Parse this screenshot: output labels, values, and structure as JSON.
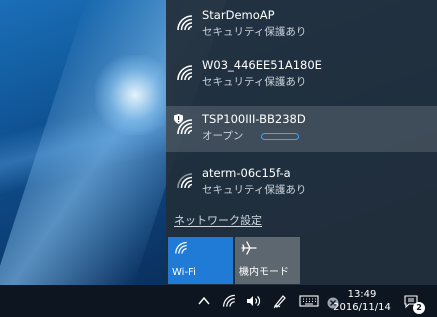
{
  "networks": [
    {
      "name": "StarDemoAP",
      "status": "セキュリティ保護あり",
      "selected": false,
      "secured": true
    },
    {
      "name": "W03_446EE51A180E",
      "status": "セキュリティ保護あり",
      "selected": false,
      "secured": true
    },
    {
      "name": "TSP100III-BB238D",
      "status": "オープン",
      "selected": true,
      "secured": false
    },
    {
      "name": "aterm-06c15f-a",
      "status": "セキュリティ保護あり",
      "selected": false,
      "secured": true
    }
  ],
  "settings_link": "ネットワーク設定",
  "quick_actions": {
    "wifi_label": "Wi-Fi",
    "airplane_label": "機内モード"
  },
  "taskbar": {
    "time": "13:49",
    "date": "2016/11/14",
    "notification_count": "2"
  },
  "colors": {
    "accent": "#1f7bd6",
    "flyout_bg": "#222e3a",
    "taskbar_bg": "#0d1620"
  }
}
